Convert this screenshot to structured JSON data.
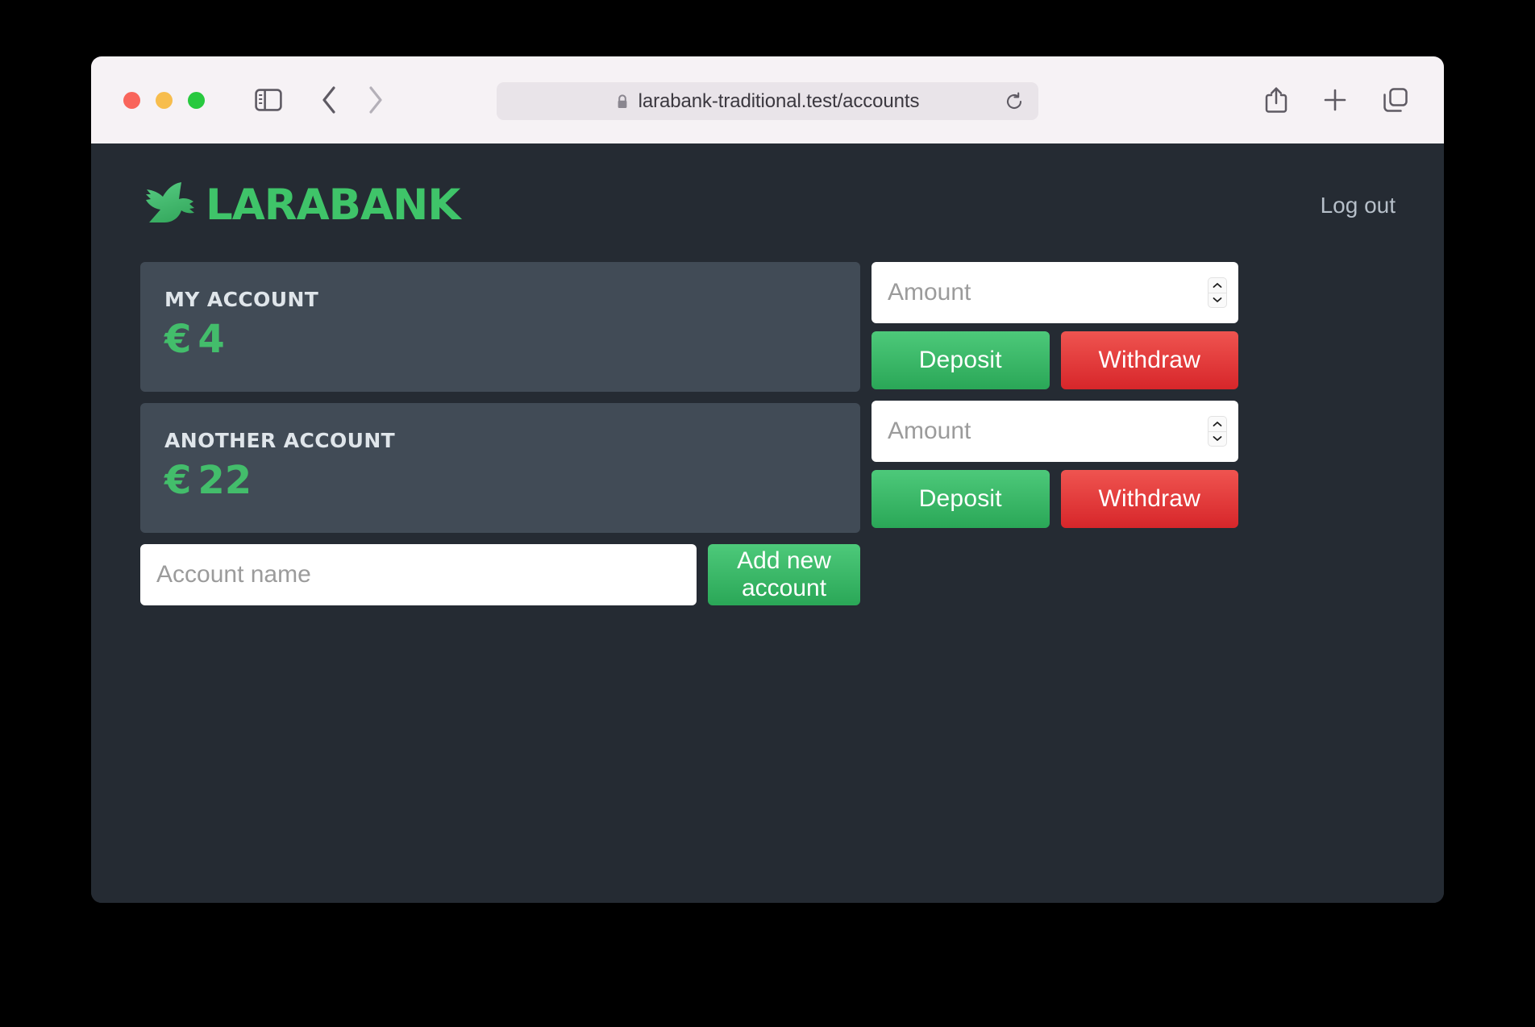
{
  "browser": {
    "url": "larabank-traditional.test/accounts",
    "window_controls": [
      {
        "name": "close",
        "color": "#f9655b"
      },
      {
        "name": "minimize",
        "color": "#f7bd4d"
      },
      {
        "name": "maximize",
        "color": "#28c93f"
      }
    ],
    "icons": {
      "sidebar": "sidebar-icon",
      "back": "chevron-left-icon",
      "forward": "chevron-right-icon",
      "lock": "lock-icon",
      "reload": "reload-icon",
      "share": "share-icon",
      "new_tab": "plus-icon",
      "tab_overview": "tabs-icon"
    }
  },
  "header": {
    "brand_name": "LARABANK",
    "brand_mark": "bird-logo-icon",
    "logout_label": "Log out"
  },
  "colors": {
    "page_background": "#252b33",
    "card_background": "#414b56",
    "accent_green": "#43bd6b",
    "danger_red": "#d7262a",
    "toolbar_background": "#f6f2f5",
    "heading_text": "#dfe5ea"
  },
  "accounts": [
    {
      "name": "MY ACCOUNT",
      "currency": "€",
      "balance": "4",
      "amount_placeholder": "Amount",
      "amount_value": "",
      "deposit_label": "Deposit",
      "withdraw_label": "Withdraw"
    },
    {
      "name": "ANOTHER ACCOUNT",
      "currency": "€",
      "balance": "22",
      "amount_placeholder": "Amount",
      "amount_value": "",
      "deposit_label": "Deposit",
      "withdraw_label": "Withdraw"
    }
  ],
  "new_account": {
    "name_placeholder": "Account name",
    "name_value": "",
    "submit_label": "Add new account"
  }
}
